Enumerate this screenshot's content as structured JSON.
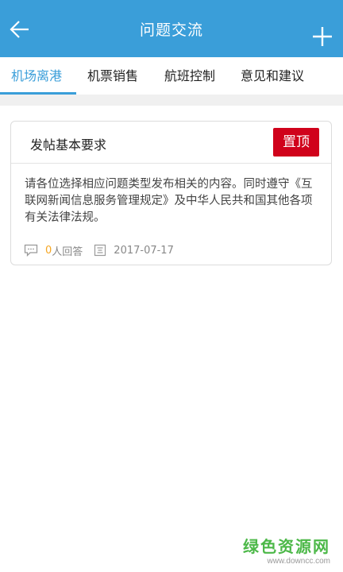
{
  "header": {
    "title": "问题交流",
    "back_icon": "arrow-left-icon",
    "add_icon": "plus-icon",
    "color": "#3a9ed9"
  },
  "tabs": [
    {
      "label": "机场离港",
      "active": true
    },
    {
      "label": "机票销售",
      "active": false
    },
    {
      "label": "航班控制",
      "active": false
    },
    {
      "label": "意见和建议",
      "active": false
    }
  ],
  "post": {
    "title": "发帖基本要求",
    "badge": "置顶",
    "body": "请各位选择相应问题类型发布相关的内容。同时遵守《互联网新闻信息服务管理规定》及中华人民共和国其他各项有关法律法规。",
    "reply_count": "0",
    "reply_suffix": "人回答",
    "date": "2017-07-17",
    "badge_color": "#d0021b"
  },
  "watermark": {
    "main": "绿色资源网",
    "sub": "www.downcc.com"
  }
}
